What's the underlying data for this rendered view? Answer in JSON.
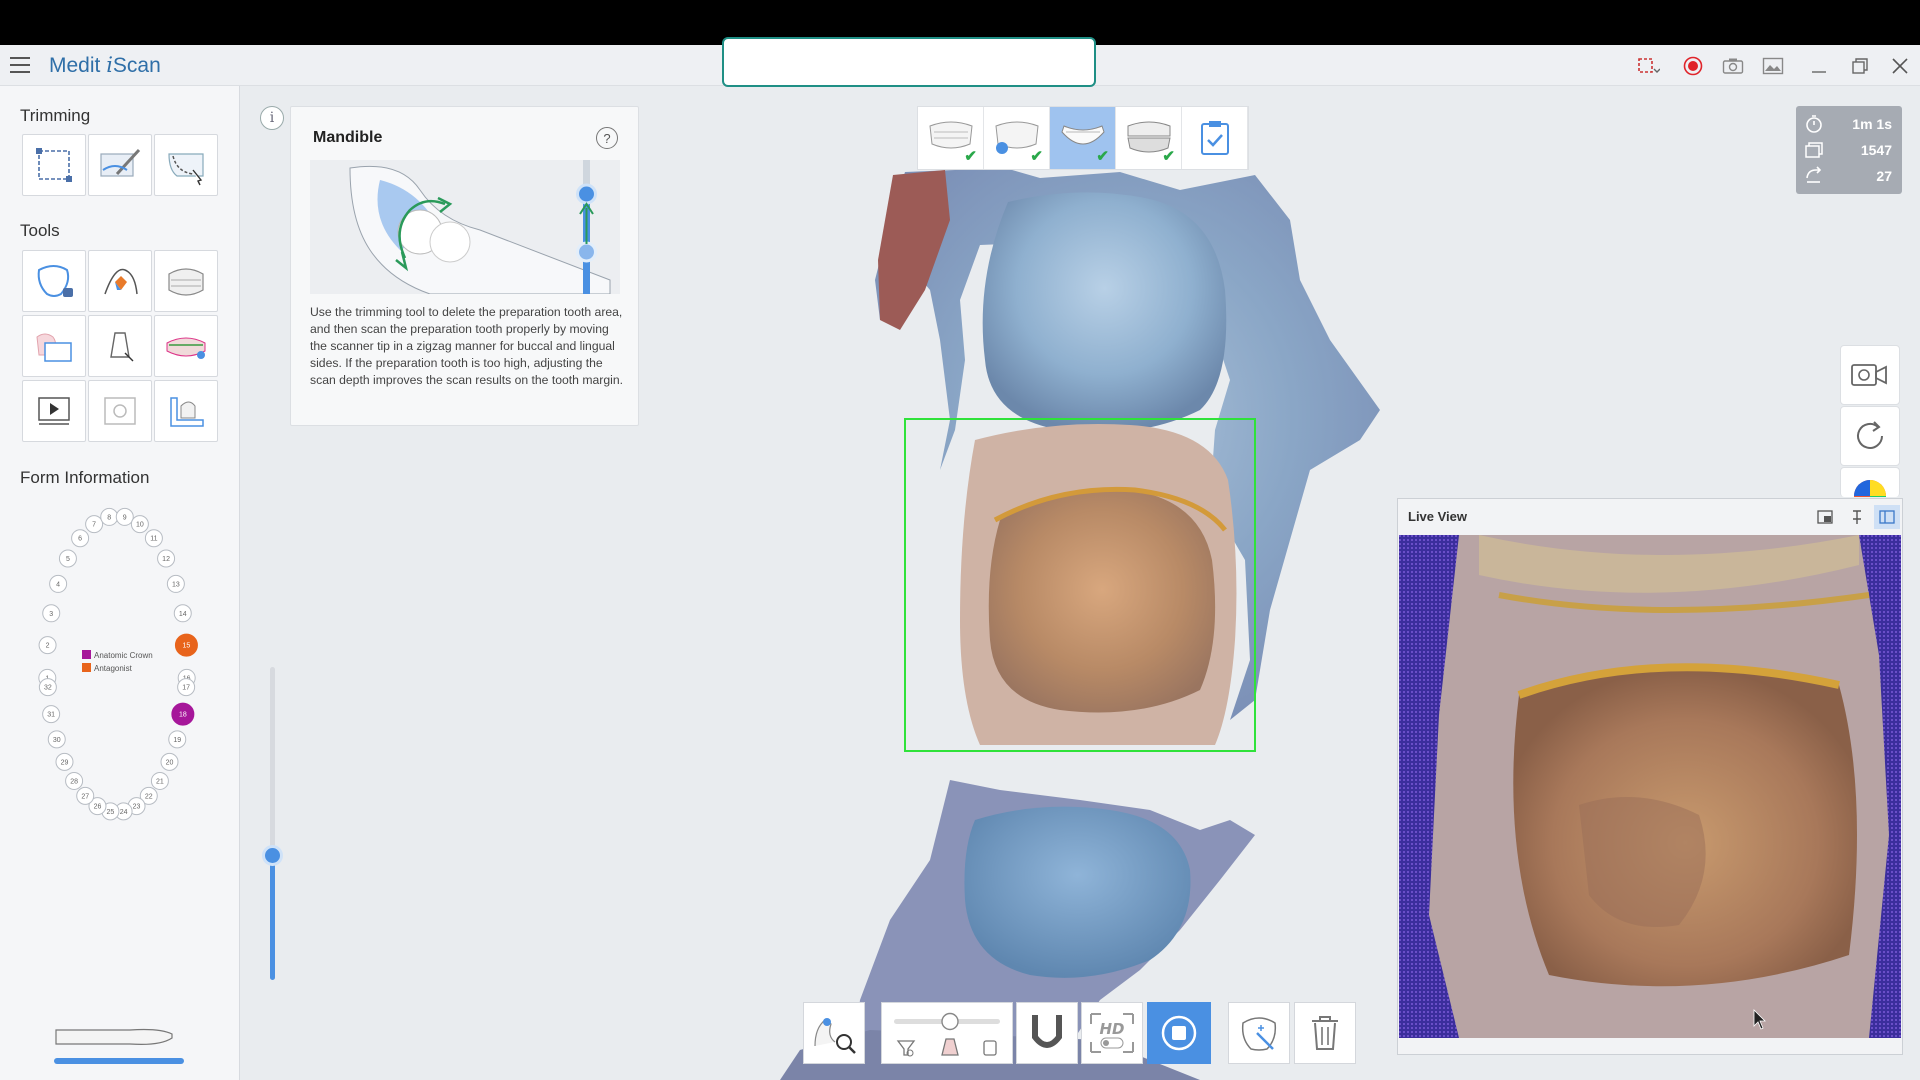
{
  "app": {
    "title_prefix": "Medit ",
    "title_i": "i",
    "title_suffix": "Scan"
  },
  "sidebar": {
    "trimming_title": "Trimming",
    "tools_title": "Tools",
    "form_title": "Form Information",
    "legend": [
      {
        "label": "Anatomic Crown",
        "color": "#a6179a"
      },
      {
        "label": "Antagonist",
        "color": "#e8641c"
      }
    ],
    "upper_teeth": [
      "1",
      "2",
      "3",
      "4",
      "5",
      "6",
      "7",
      "8",
      "9",
      "10",
      "11",
      "12",
      "13",
      "14",
      "15",
      "16"
    ],
    "lower_teeth": [
      "17",
      "18",
      "19",
      "20",
      "21",
      "22",
      "23",
      "24",
      "25",
      "26",
      "27",
      "28",
      "29",
      "30",
      "31",
      "32"
    ]
  },
  "guide": {
    "title": "Mandible",
    "help": "?",
    "info": "i",
    "text": "Use the trimming tool to delete the preparation tooth area, and then scan the preparation tooth properly by moving the scanner tip in a zigzag manner for buccal and lingual sides. If the preparation tooth is too high, adjusting the scan depth improves the scan results on the tooth margin."
  },
  "stats": {
    "time": "1m 1s",
    "frames": "1547",
    "count": "27"
  },
  "live_view": {
    "title": "Live View"
  },
  "colors": {
    "accent": "#4a90e2",
    "active_tab": "#9fc3ef",
    "check": "#2aa84a",
    "record": "#e0242a",
    "toast_border": "#1f8f85",
    "bbox": "#2fe23a"
  },
  "icons": {
    "stage_tabs": [
      "maxilla-icon",
      "pre-op-icon",
      "mandible-icon",
      "occlusion-icon",
      "checklist-icon"
    ],
    "right_buttons": [
      "video-camera-icon",
      "refresh-icon",
      "color-wheel-icon"
    ],
    "window": [
      "screen-record-icon",
      "record-icon",
      "screenshot-icon",
      "gallery-icon",
      "minimize-icon",
      "restore-icon",
      "close-icon"
    ]
  }
}
